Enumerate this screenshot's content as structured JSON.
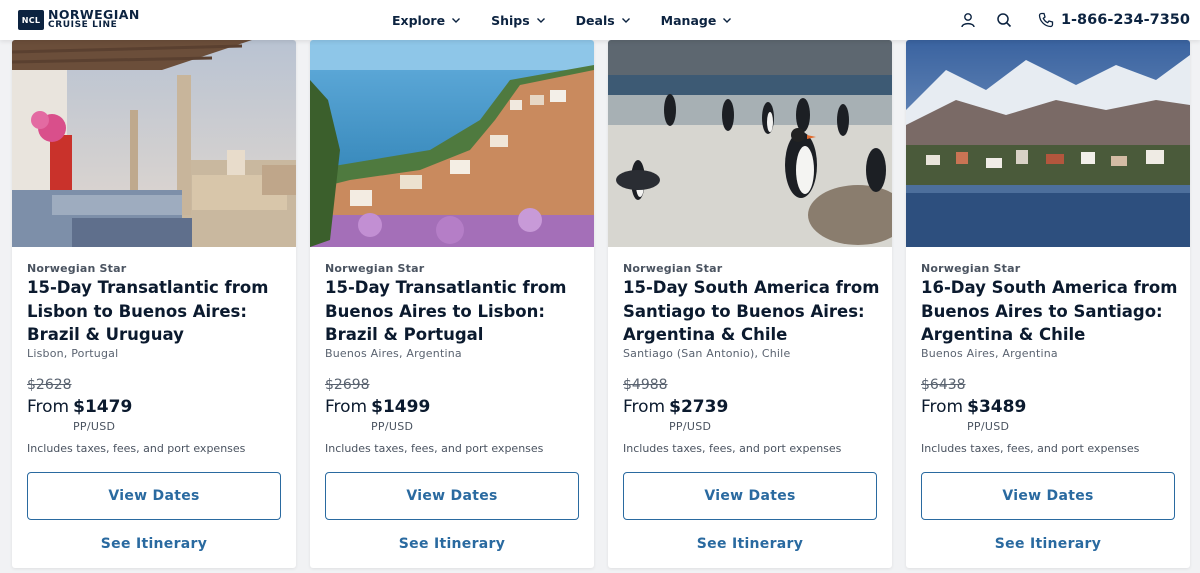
{
  "header": {
    "logo_badge": "NCL",
    "logo_line1": "NORWEGIAN",
    "logo_line2": "CRUISE LINE",
    "nav": [
      {
        "label": "Explore"
      },
      {
        "label": "Ships"
      },
      {
        "label": "Deals"
      },
      {
        "label": "Manage"
      }
    ],
    "phone": "1-866-234-7350",
    "icons": [
      "user-icon",
      "search-icon",
      "phone-icon"
    ]
  },
  "colors": {
    "navy": "#0c2340",
    "link_blue": "#2a6aa0",
    "background": "#f1f2f4"
  },
  "cards": [
    {
      "ship": "Norwegian Star",
      "title": "15-Day Transatlantic from Lisbon to Buenos Aires: Brazil & Uruguay",
      "port": "Lisbon, Portugal",
      "old_price": "$2628",
      "from_label": "From",
      "price": "$1479",
      "unit": "PP/USD",
      "includes": "Includes taxes, fees, and port expenses",
      "view_label": "View Dates",
      "itinerary_label": "See Itinerary",
      "image": "lisbon-terrace-image"
    },
    {
      "ship": "Norwegian Star",
      "title": "15-Day Transatlantic from Buenos Aires to Lisbon: Brazil & Portugal",
      "port": "Buenos Aires, Argentina",
      "old_price": "$2698",
      "from_label": "From",
      "price": "$1499",
      "unit": "PP/USD",
      "includes": "Includes taxes, fees, and port expenses",
      "view_label": "View Dates",
      "itinerary_label": "See Itinerary",
      "image": "coastal-town-image"
    },
    {
      "ship": "Norwegian Star",
      "title": "15-Day South America from Santiago to Buenos Aires: Argentina & Chile",
      "port": "Santiago (San Antonio), Chile",
      "old_price": "$4988",
      "from_label": "From",
      "price": "$2739",
      "unit": "PP/USD",
      "includes": "Includes taxes, fees, and port expenses",
      "view_label": "View Dates",
      "itinerary_label": "See Itinerary",
      "image": "penguins-beach-image"
    },
    {
      "ship": "Norwegian Star",
      "title": "16-Day South America from Buenos Aires to Santiago: Argentina & Chile",
      "port": "Buenos Aires, Argentina",
      "old_price": "$6438",
      "from_label": "From",
      "price": "$3489",
      "unit": "PP/USD",
      "includes": "Includes taxes, fees, and port expenses",
      "view_label": "View Dates",
      "itinerary_label": "See Itinerary",
      "image": "mountain-harbor-image"
    }
  ]
}
